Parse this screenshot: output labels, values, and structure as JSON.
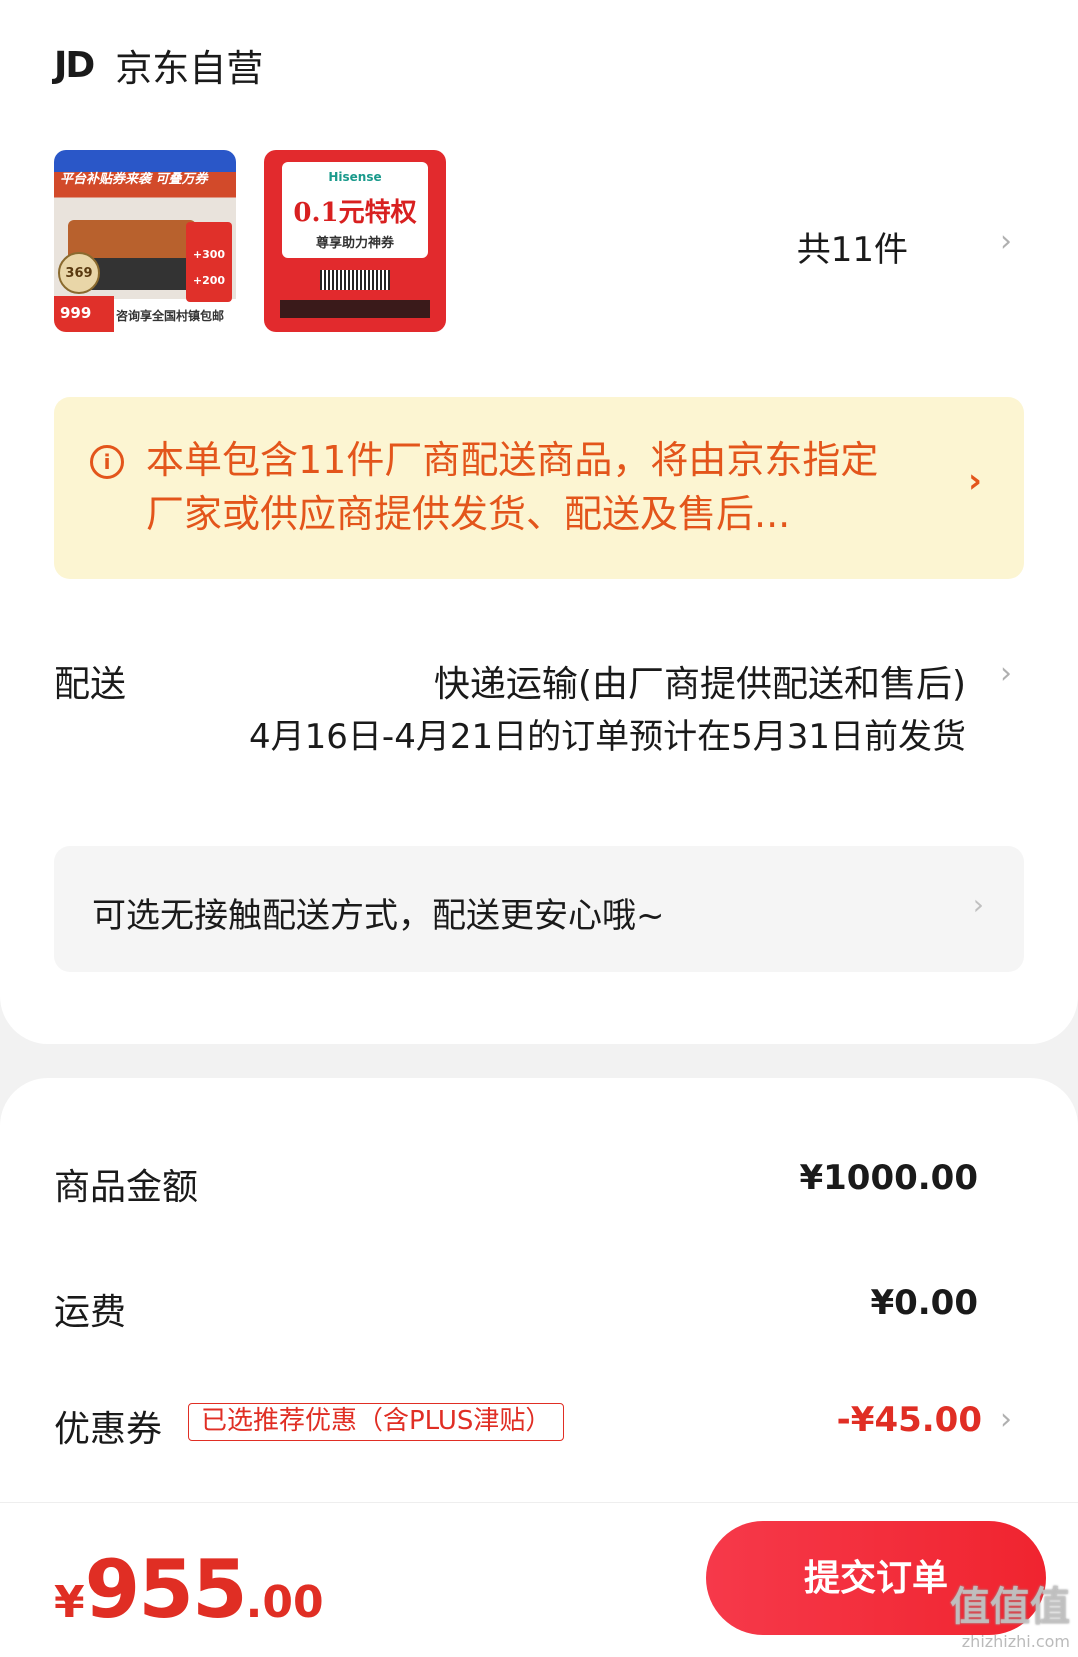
{
  "shop": {
    "logo": "JD",
    "name": "京东自营"
  },
  "products": {
    "thumb1": {
      "banner": "平台补贴券来袭 可叠万券",
      "seal": "369",
      "price": "999",
      "tag": "+300 +200",
      "footer": "咨询享全国村镇包邮"
    },
    "thumb2": {
      "brand": "Hisense",
      "headline": "0.1元特权",
      "sub": "尊享助力神券"
    },
    "count_label": "共11件"
  },
  "notice": {
    "icon": "info-icon",
    "text": "本单包含11件厂商配送商品，将由京东指定厂家或供应商提供发货、配送及售后...",
    "color": "#e3551b"
  },
  "delivery": {
    "label": "配送",
    "method": "快递运输(由厂商提供配送和售后)",
    "note": "4月16日-4月21日的订单预计在5月31日前发货"
  },
  "contactless": {
    "text": "可选无接触配送方式，配送更安心哦~"
  },
  "summary": {
    "goods_label": "商品金额",
    "goods_value": "¥1000.00",
    "shipping_label": "运费",
    "shipping_value": "¥0.00",
    "coupon_label": "优惠券",
    "coupon_tag": "已选推荐优惠（含PLUS津贴）",
    "coupon_value": "-¥45.00"
  },
  "footer": {
    "total_symbol": "¥",
    "total_int": "955",
    "total_dec": ".00",
    "submit_label": "提交订单",
    "watermark": "值值值",
    "watermark_url": "zhizhizhi.com"
  },
  "colors": {
    "accent": "#e02e24",
    "notice_bg": "#fcf5d2"
  }
}
